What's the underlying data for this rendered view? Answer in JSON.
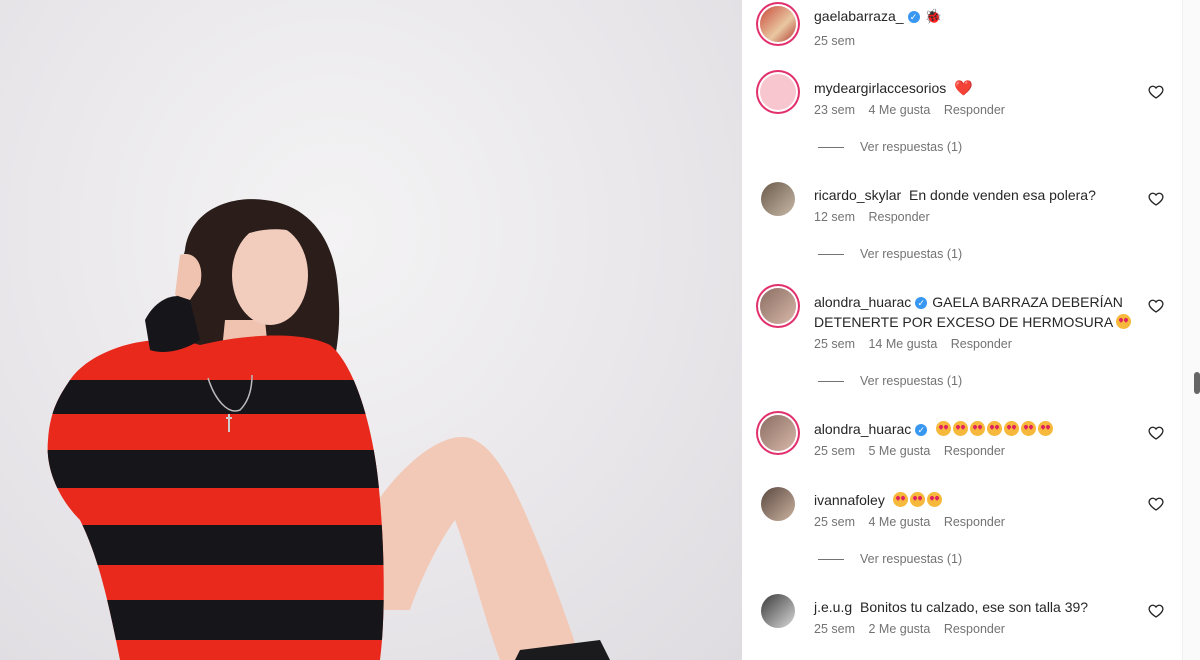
{
  "post": {
    "author": "gaelabarraza_",
    "author_emoji": "🐞",
    "time": "25 sem"
  },
  "comments": [
    {
      "user": "mydeargirlaccesorios",
      "text": "",
      "emoji": "❤️",
      "time": "23 sem",
      "likes": "4 Me gusta",
      "reply": "Responder",
      "view_replies": "Ver respuestas (1)"
    },
    {
      "user": "ricardo_skylar",
      "text": "En donde venden esa polera?",
      "time": "12 sem",
      "reply": "Responder",
      "view_replies": "Ver respuestas (1)"
    },
    {
      "user": "alondra_huarac",
      "text": "GAELA BARRAZA DEBERÍAN DETENERTE POR EXCESO DE HERMOSURA",
      "time": "25 sem",
      "likes": "14 Me gusta",
      "reply": "Responder",
      "view_replies": "Ver respuestas (1)"
    },
    {
      "user": "alondra_huarac",
      "text": "",
      "time": "25 sem",
      "likes": "5 Me gusta",
      "reply": "Responder"
    },
    {
      "user": "ivannafoley",
      "text": "",
      "time": "25 sem",
      "likes": "4 Me gusta",
      "reply": "Responder",
      "view_replies": "Ver respuestas (1)"
    },
    {
      "user": "j.e.u.g",
      "text": "Bonitos tu calzado, ese son talla 39?",
      "time": "25 sem",
      "likes": "2 Me gusta",
      "reply": "Responder"
    }
  ],
  "colors": {
    "accent_ring": "#e1306c",
    "verified": "#3897f0",
    "sweater_red": "#e8291c",
    "sweater_black": "#16151a"
  }
}
